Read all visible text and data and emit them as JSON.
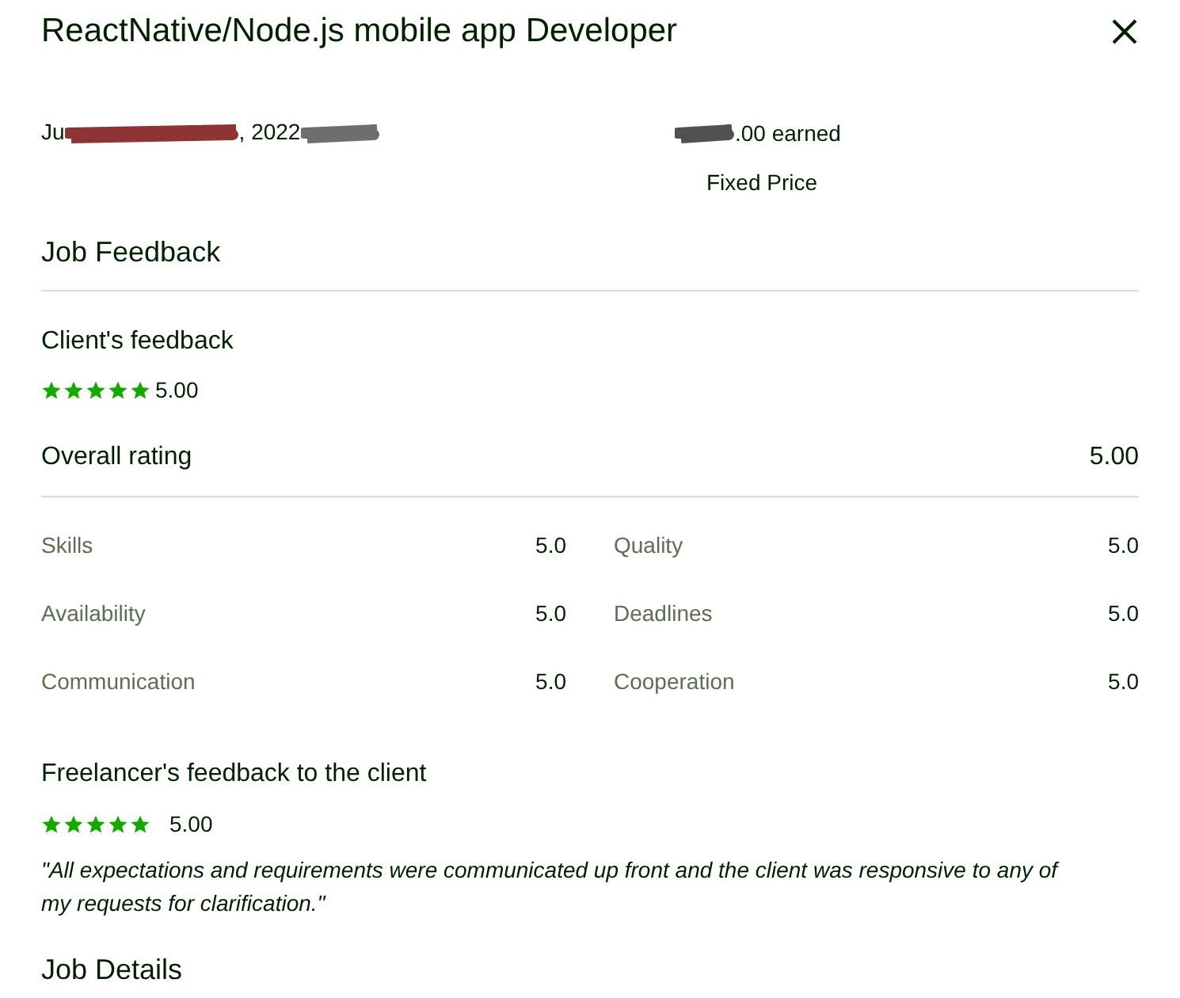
{
  "title": "ReactNative/Node.js mobile app Developer",
  "summary": {
    "date_start": "Ju",
    "date_end": ", 2022",
    "earned": ".00 earned",
    "type": "Fixed Price"
  },
  "job_feedback": {
    "heading": "Job Feedback",
    "client_heading": "Client's feedback",
    "client_rating": {
      "stars": 5,
      "score": "5.00"
    },
    "overall_label": "Overall rating",
    "overall_score": "5.00",
    "ratings": [
      {
        "label": "Skills",
        "value": "5.0"
      },
      {
        "label": "Quality",
        "value": "5.0"
      },
      {
        "label": "Availability",
        "value": "5.0"
      },
      {
        "label": "Deadlines",
        "value": "5.0"
      },
      {
        "label": "Communication",
        "value": "5.0"
      },
      {
        "label": "Cooperation",
        "value": "5.0"
      }
    ]
  },
  "freelancer_feedback": {
    "heading": "Freelancer's feedback to the client",
    "stars": 5,
    "score": "5.00",
    "comment": "\"All expectations and requirements were communicated up front and the client was responsive to any of my requests for clarification.\""
  },
  "job_details_heading": "Job Details"
}
